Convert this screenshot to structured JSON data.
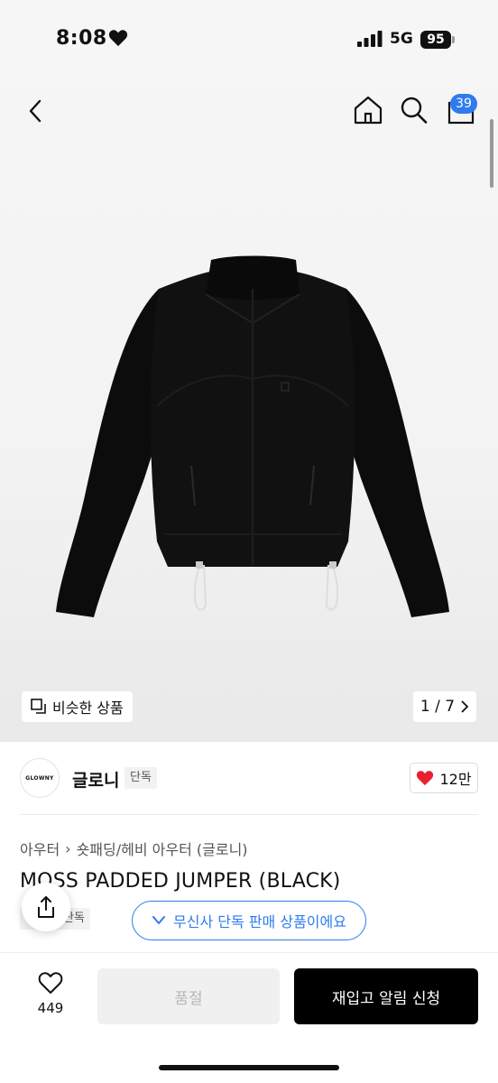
{
  "status": {
    "time": "8:08",
    "network": "5G",
    "battery": "95"
  },
  "nav": {
    "cart_badge": "39"
  },
  "gallery": {
    "similar_label": "비슷한 상품",
    "page_indicator": "1 / 7"
  },
  "brand": {
    "logo_text": "GLOWNY",
    "name": "글로니",
    "tag": "단독",
    "likes": "12만"
  },
  "breadcrumb": {
    "category": "아우터",
    "subcategory": "숏패딩/헤비 아우터 (글로니)"
  },
  "product": {
    "title": "MOSS PADDED JUMPER (BLACK)",
    "tag": "단독"
  },
  "exclusive_banner": "무신사 단독 판매 상품이에요",
  "bottom_bar": {
    "wish_count": "449",
    "soldout_label": "품절",
    "restock_label": "재입고 알림 신청"
  },
  "colors": {
    "accent": "#2f7bf0",
    "like": "#e8202f",
    "primary_button": "#000000"
  },
  "icons": [
    "back-icon",
    "home-icon",
    "search-icon",
    "bag-icon",
    "copy-icon",
    "chevron-right-icon",
    "heart-icon",
    "share-icon",
    "check-icon",
    "heart-outline-icon"
  ]
}
